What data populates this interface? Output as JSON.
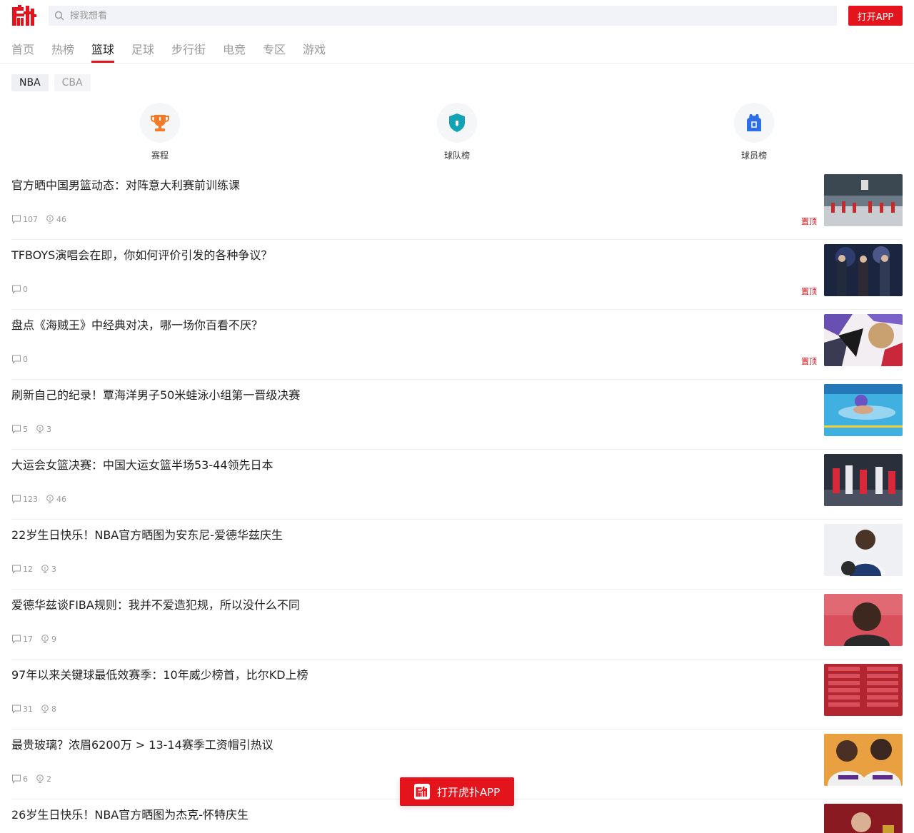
{
  "header": {
    "logo_icon": "hupu-logo-icon",
    "search_placeholder": "搜我想看",
    "open_app_label": "打开APP"
  },
  "nav": {
    "items": [
      {
        "label": "首页"
      },
      {
        "label": "热榜"
      },
      {
        "label": "篮球"
      },
      {
        "label": "足球"
      },
      {
        "label": "步行街"
      },
      {
        "label": "电竞"
      },
      {
        "label": "专区"
      },
      {
        "label": "游戏"
      }
    ],
    "active": "篮球"
  },
  "subtabs": [
    {
      "label": "NBA"
    },
    {
      "label": "CBA"
    }
  ],
  "quick_links": [
    {
      "label": "赛程",
      "icon": "trophy-icon"
    },
    {
      "label": "球队榜",
      "icon": "shield-icon"
    },
    {
      "label": "球员榜",
      "icon": "jersey-icon"
    }
  ],
  "posts": [
    {
      "title": "官方晒中国男篮动态：对阵意大利赛前训练课",
      "comments": "107",
      "lights": "46",
      "pinned": "置顶"
    },
    {
      "title": "TFBOYS演唱会在即，你如何评价引发的各种争议？",
      "comments": "0",
      "lights": "",
      "pinned": "置顶"
    },
    {
      "title": "盘点《海贼王》中经典对决，哪一场你百看不厌？",
      "comments": "0",
      "lights": "",
      "pinned": "置顶"
    },
    {
      "title": "刷新自己的纪录！覃海洋男子50米蛙泳小组第一晋级决赛",
      "comments": "5",
      "lights": "3",
      "pinned": ""
    },
    {
      "title": "大运会女篮决赛：中国大运女篮半场53-44领先日本",
      "comments": "123",
      "lights": "46",
      "pinned": ""
    },
    {
      "title": "22岁生日快乐！NBA官方晒图为安东尼-爱德华兹庆生",
      "comments": "12",
      "lights": "3",
      "pinned": ""
    },
    {
      "title": "爱德华兹谈FIBA规则：我并不爱造犯规，所以没什么不同",
      "comments": "17",
      "lights": "9",
      "pinned": ""
    },
    {
      "title": "97年以来关键球最低效赛季：10年威少榜首，比尔KD上榜",
      "comments": "31",
      "lights": "8",
      "pinned": ""
    },
    {
      "title": "最贵玻璃？浓眉6200万 > 13-14赛季工资帽引热议",
      "comments": "6",
      "lights": "2",
      "pinned": ""
    },
    {
      "title": "26岁生日快乐！NBA官方晒图为杰克-怀特庆生",
      "comments": "",
      "lights": "",
      "pinned": ""
    }
  ],
  "float_button": {
    "label": "打开虎扑APP"
  },
  "colors": {
    "accent": "#e4141d"
  }
}
